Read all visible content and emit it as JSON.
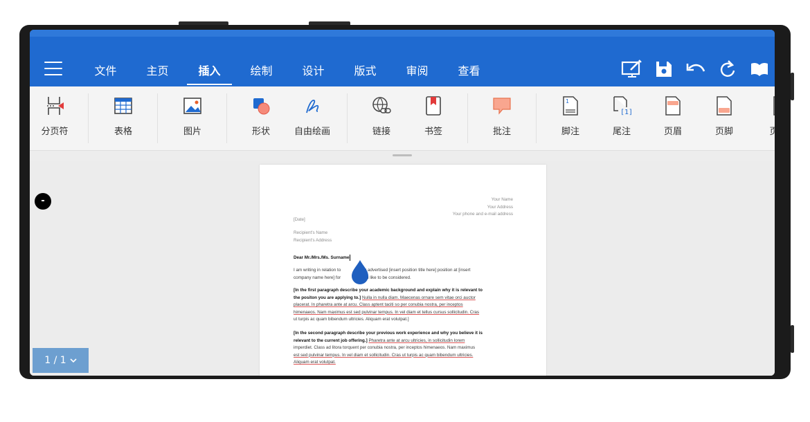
{
  "menu_tabs": [
    {
      "label": "文件"
    },
    {
      "label": "主页"
    },
    {
      "label": "插入"
    },
    {
      "label": "绘制"
    },
    {
      "label": "设计"
    },
    {
      "label": "版式"
    },
    {
      "label": "审阅"
    },
    {
      "label": "查看"
    }
  ],
  "active_tab": "插入",
  "accent_color": "#1f6ad0",
  "toolbar_icons": [
    "present-icon",
    "save-icon",
    "undo-icon",
    "redo-icon",
    "read-mode-icon"
  ],
  "ribbon": [
    {
      "label": "分页符",
      "icon": "page-break-icon"
    },
    {
      "label": "表格",
      "icon": "table-icon"
    },
    {
      "label": "图片",
      "icon": "picture-icon"
    },
    {
      "label": "形状",
      "icon": "shape-icon"
    },
    {
      "label": "自由绘画",
      "icon": "freehand-icon"
    },
    {
      "label": "链接",
      "icon": "link-icon"
    },
    {
      "label": "书签",
      "icon": "bookmark-icon"
    },
    {
      "label": "批注",
      "icon": "comment-icon"
    },
    {
      "label": "脚注",
      "icon": "footnote-icon"
    },
    {
      "label": "尾注",
      "icon": "endnote-icon"
    },
    {
      "label": "页眉",
      "icon": "header-icon"
    },
    {
      "label": "页脚",
      "icon": "footer-icon"
    },
    {
      "label": "页",
      "icon": "page-number-icon"
    }
  ],
  "document": {
    "sender": [
      "Your Name",
      "Your Address",
      "Your phone and e-mail address"
    ],
    "date": "[Date]",
    "recipient": [
      "Recipient's Name",
      "Recipient's Address"
    ],
    "salutation": "Dear Mr./Mrs./Ms. Surname",
    "p1_a": "I am writing in relation to",
    "p1_b": "ently advertised [insert position title here] position at [insert",
    "p1_c": "company name here] for",
    "p1_d": "would like to be considered.",
    "p2_head": "[In the first paragraph describe your academic background and explain why it is relevant to",
    "p2_head_b": "the positon you are applying to.]",
    "p2_lines": [
      "Nulla in nulla diam. Maecenas ornare sem vitae orci auctor",
      "placerat. In pharetra ante at arcu. Class aptent taciti so per conubia nostra, per inceptos",
      "himenaeos. Nam maximus est sed pulvinar tempus. In vel diam et tellus cursus sollicitudin. Cras",
      "ut turpis ac quam bibendum ultricies. Aliquam erat volutpat.]"
    ],
    "p3_head": "[In the second paragraph describe your previous work experience and why you believe it is",
    "p3_head_b": "relevant to the current job offering.]",
    "p3_lines": [
      "Pharetra ante at arcu ultricies, in sollicitudin lorem",
      "imperdiet. Class ad litora torquent per conubia nostra, per inceptos himenaeos. Nam maximus",
      "est sed pulvinar tempus. In vel diam et sollicitudin. Cras ut turpis ac quam bibendum ultricies.",
      "Aliquam erat volutpat."
    ]
  },
  "page_indicator": "1 / 1"
}
